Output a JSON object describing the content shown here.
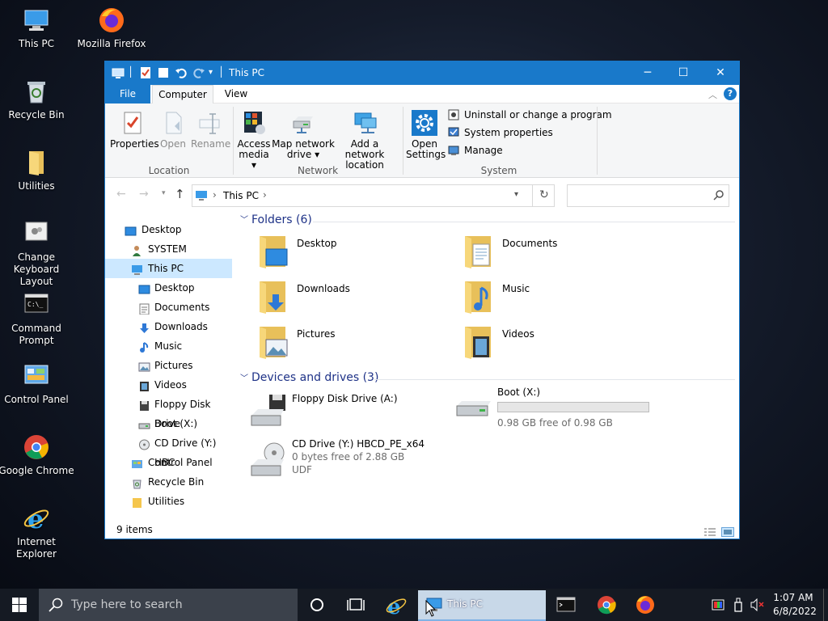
{
  "desktop": {
    "icons": [
      {
        "label": "This PC",
        "icon": "this-pc-icon"
      },
      {
        "label": "Mozilla Firefox",
        "icon": "firefox-icon"
      },
      {
        "label": "Recycle Bin",
        "icon": "recycle-bin-icon"
      },
      {
        "label": "Utilities",
        "icon": "folder-icon"
      },
      {
        "label": "Change Keyboard Layout",
        "icon": "keyboard-layout-icon"
      },
      {
        "label": "Command Prompt",
        "icon": "command-prompt-icon"
      },
      {
        "label": "Control Panel",
        "icon": "control-panel-icon"
      },
      {
        "label": "Google Chrome",
        "icon": "chrome-icon"
      },
      {
        "label": "Internet Explorer",
        "icon": "ie-icon"
      }
    ]
  },
  "window": {
    "title": "This PC",
    "controls": {
      "minimize": "─",
      "maximize": "☐",
      "close": "✕"
    },
    "tabs": [
      "File",
      "Computer",
      "View"
    ],
    "help": "?",
    "ribbon": {
      "location": {
        "label": "Location",
        "buttons": [
          "Properties",
          "Open",
          "Rename"
        ]
      },
      "network": {
        "label": "Network",
        "access_media": [
          "Access",
          "media ▾"
        ],
        "map_drive": [
          "Map network",
          "drive ▾"
        ],
        "add_location": [
          "Add a network",
          "location"
        ]
      },
      "system": {
        "label": "System",
        "open_settings": [
          "Open",
          "Settings"
        ],
        "items": [
          "Uninstall or change a program",
          "System properties",
          "Manage"
        ]
      }
    },
    "address": {
      "path": "This PC",
      "search_placeholder": ""
    },
    "nav": [
      "Desktop",
      "SYSTEM",
      "This PC",
      "Desktop",
      "Documents",
      "Downloads",
      "Music",
      "Pictures",
      "Videos",
      "Floppy Disk Drive",
      "Boot (X:)",
      "CD Drive (Y:) HBC",
      "Control Panel",
      "Recycle Bin",
      "Utilities"
    ],
    "folders_header": "Folders (6)",
    "folders": [
      "Desktop",
      "Documents",
      "Downloads",
      "Music",
      "Pictures",
      "Videos"
    ],
    "drives_header": "Devices and drives (3)",
    "drives": [
      {
        "name": "Floppy Disk Drive (A:)",
        "free": "",
        "fs": ""
      },
      {
        "name": "Boot (X:)",
        "free": "0.98 GB free of 0.98 GB",
        "fs": "",
        "used_fraction": 0.0
      },
      {
        "name": "CD Drive (Y:) HBCD_PE_x64",
        "free": "0 bytes free of 2.88 GB",
        "fs": "UDF"
      }
    ],
    "status": "9 items"
  },
  "taskbar": {
    "search_placeholder": "Type here to search",
    "active_app": "This PC",
    "time": "1:07 AM",
    "date": "6/8/2022"
  },
  "colors": {
    "accent": "#1979ca",
    "folder": "#f5c64d",
    "selected": "#cce8ff"
  }
}
